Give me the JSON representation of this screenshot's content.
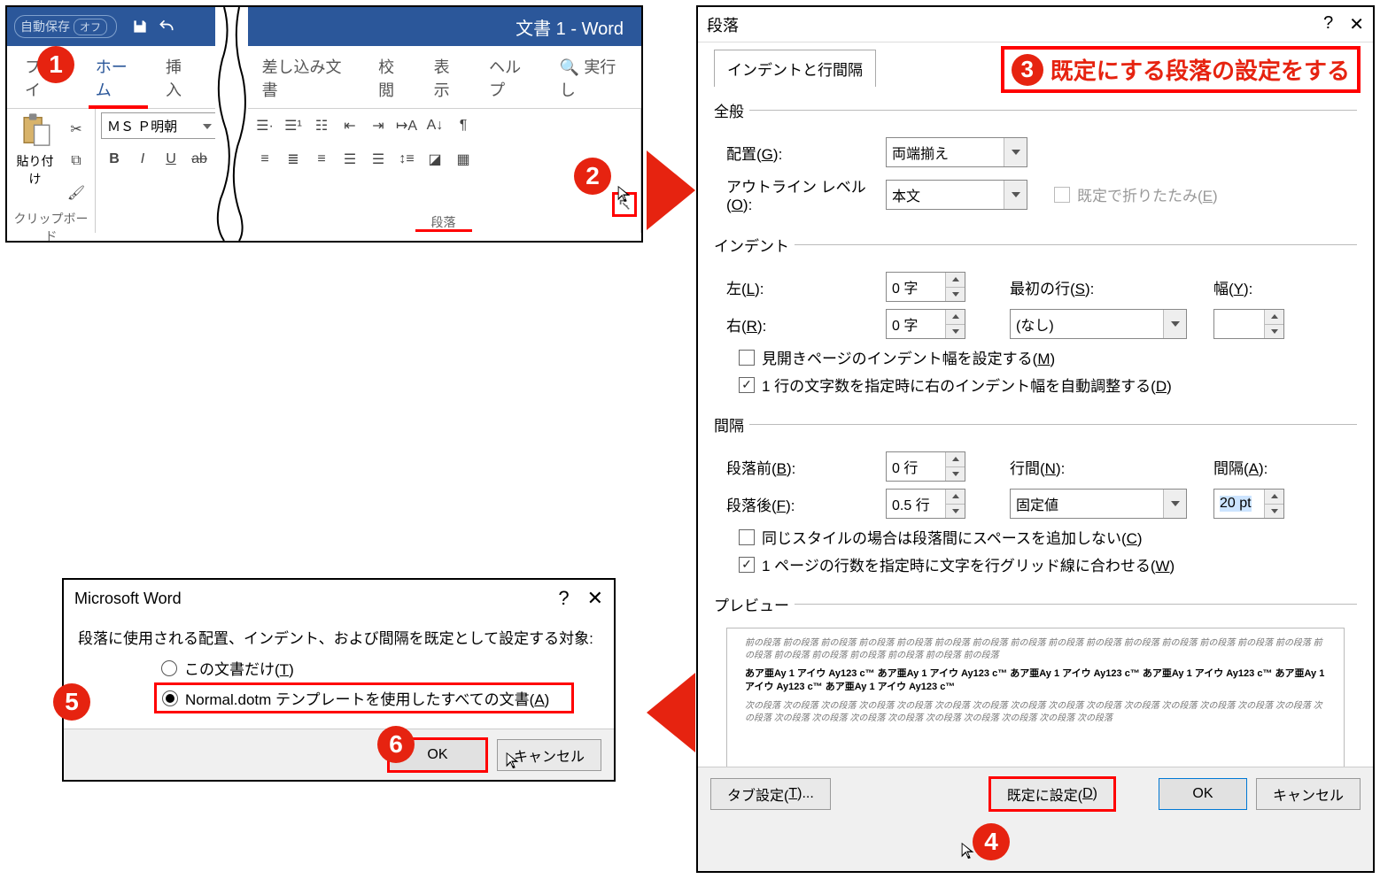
{
  "word": {
    "autosave_label": "自動保存",
    "autosave_state": "オフ",
    "doc_title": "文書 1 - Word",
    "tabs": {
      "file": "ファイ",
      "home": "ホーム",
      "insert": "挿入",
      "mail": "差し込み文書",
      "review": "校閲",
      "view": "表示",
      "help": "ヘルプ",
      "tell": "実行し"
    },
    "clipboard_label": "クリップボード",
    "paste_label": "貼り付け",
    "font_name": "ＭＳ Ｐ明朝",
    "bold": "B",
    "italic": "I",
    "underline": "U",
    "para_label": "段落"
  },
  "callout3": "既定にする段落の設定をする",
  "dlg": {
    "title": "段落",
    "tab1": "インデントと行間隔",
    "g1": "全般",
    "align_lbl": "配置(G):",
    "align_val": "両端揃え",
    "outline_lbl": "アウトライン レベル(O):",
    "outline_val": "本文",
    "collapse_lbl": "既定で折りたたみ(E)",
    "g2": "インデント",
    "left_lbl": "左(L):",
    "left_val": "0 字",
    "right_lbl": "右(R):",
    "right_val": "0 字",
    "first_lbl": "最初の行(S):",
    "first_val": "(なし)",
    "width_lbl": "幅(Y):",
    "mirror_lbl": "見開きページのインデント幅を設定する(M)",
    "auto_lbl": "1 行の文字数を指定時に右のインデント幅を自動調整する(D)",
    "g3": "間隔",
    "before_lbl": "段落前(B):",
    "before_val": "0 行",
    "after_lbl": "段落後(F):",
    "after_val": "0.5 行",
    "ls_lbl": "行間(N):",
    "ls_val": "固定値",
    "at_lbl": "間隔(A):",
    "at_val": "20 pt",
    "same_lbl": "同じスタイルの場合は段落間にスペースを追加しない(C)",
    "grid_lbl": "1 ページの行数を指定時に文字を行グリッド線に合わせる(W)",
    "g4": "プレビュー",
    "prev_before": "前の段落 前の段落 前の段落 前の段落 前の段落 前の段落 前の段落 前の段落 前の段落 前の段落 前の段落 前の段落 前の段落 前の段落 前の段落 前の段落 前の段落 前の段落 前の段落 前の段落 前の段落 前の段落",
    "prev_sample": "あア亜Ay 1 アイウ Ay123 c™ あア亜Ay 1 アイウ Ay123 c™ あア亜Ay 1 アイウ Ay123 c™ あア亜Ay 1 アイウ Ay123 c™ あア亜Ay 1 アイウ Ay123 c™ あア亜Ay 1 アイウ Ay123 c™",
    "prev_after": "次の段落 次の段落 次の段落 次の段落 次の段落 次の段落 次の段落 次の段落 次の段落 次の段落 次の段落 次の段落 次の段落 次の段落 次の段落 次の段落 次の段落 次の段落 次の段落 次の段落 次の段落 次の段落 次の段落 次の段落 次の段落",
    "tabset": "タブ設定(T)...",
    "default": "既定に設定(D)",
    "ok": "OK",
    "cancel": "キャンセル"
  },
  "msg": {
    "title": "Microsoft Word",
    "text": "段落に使用される配置、インデント、および間隔を既定として設定する対象:",
    "opt1": "この文書だけ(T)",
    "opt2": "Normal.dotm テンプレートを使用したすべての文書(A)",
    "ok": "OK",
    "cancel": "キャンセル"
  }
}
